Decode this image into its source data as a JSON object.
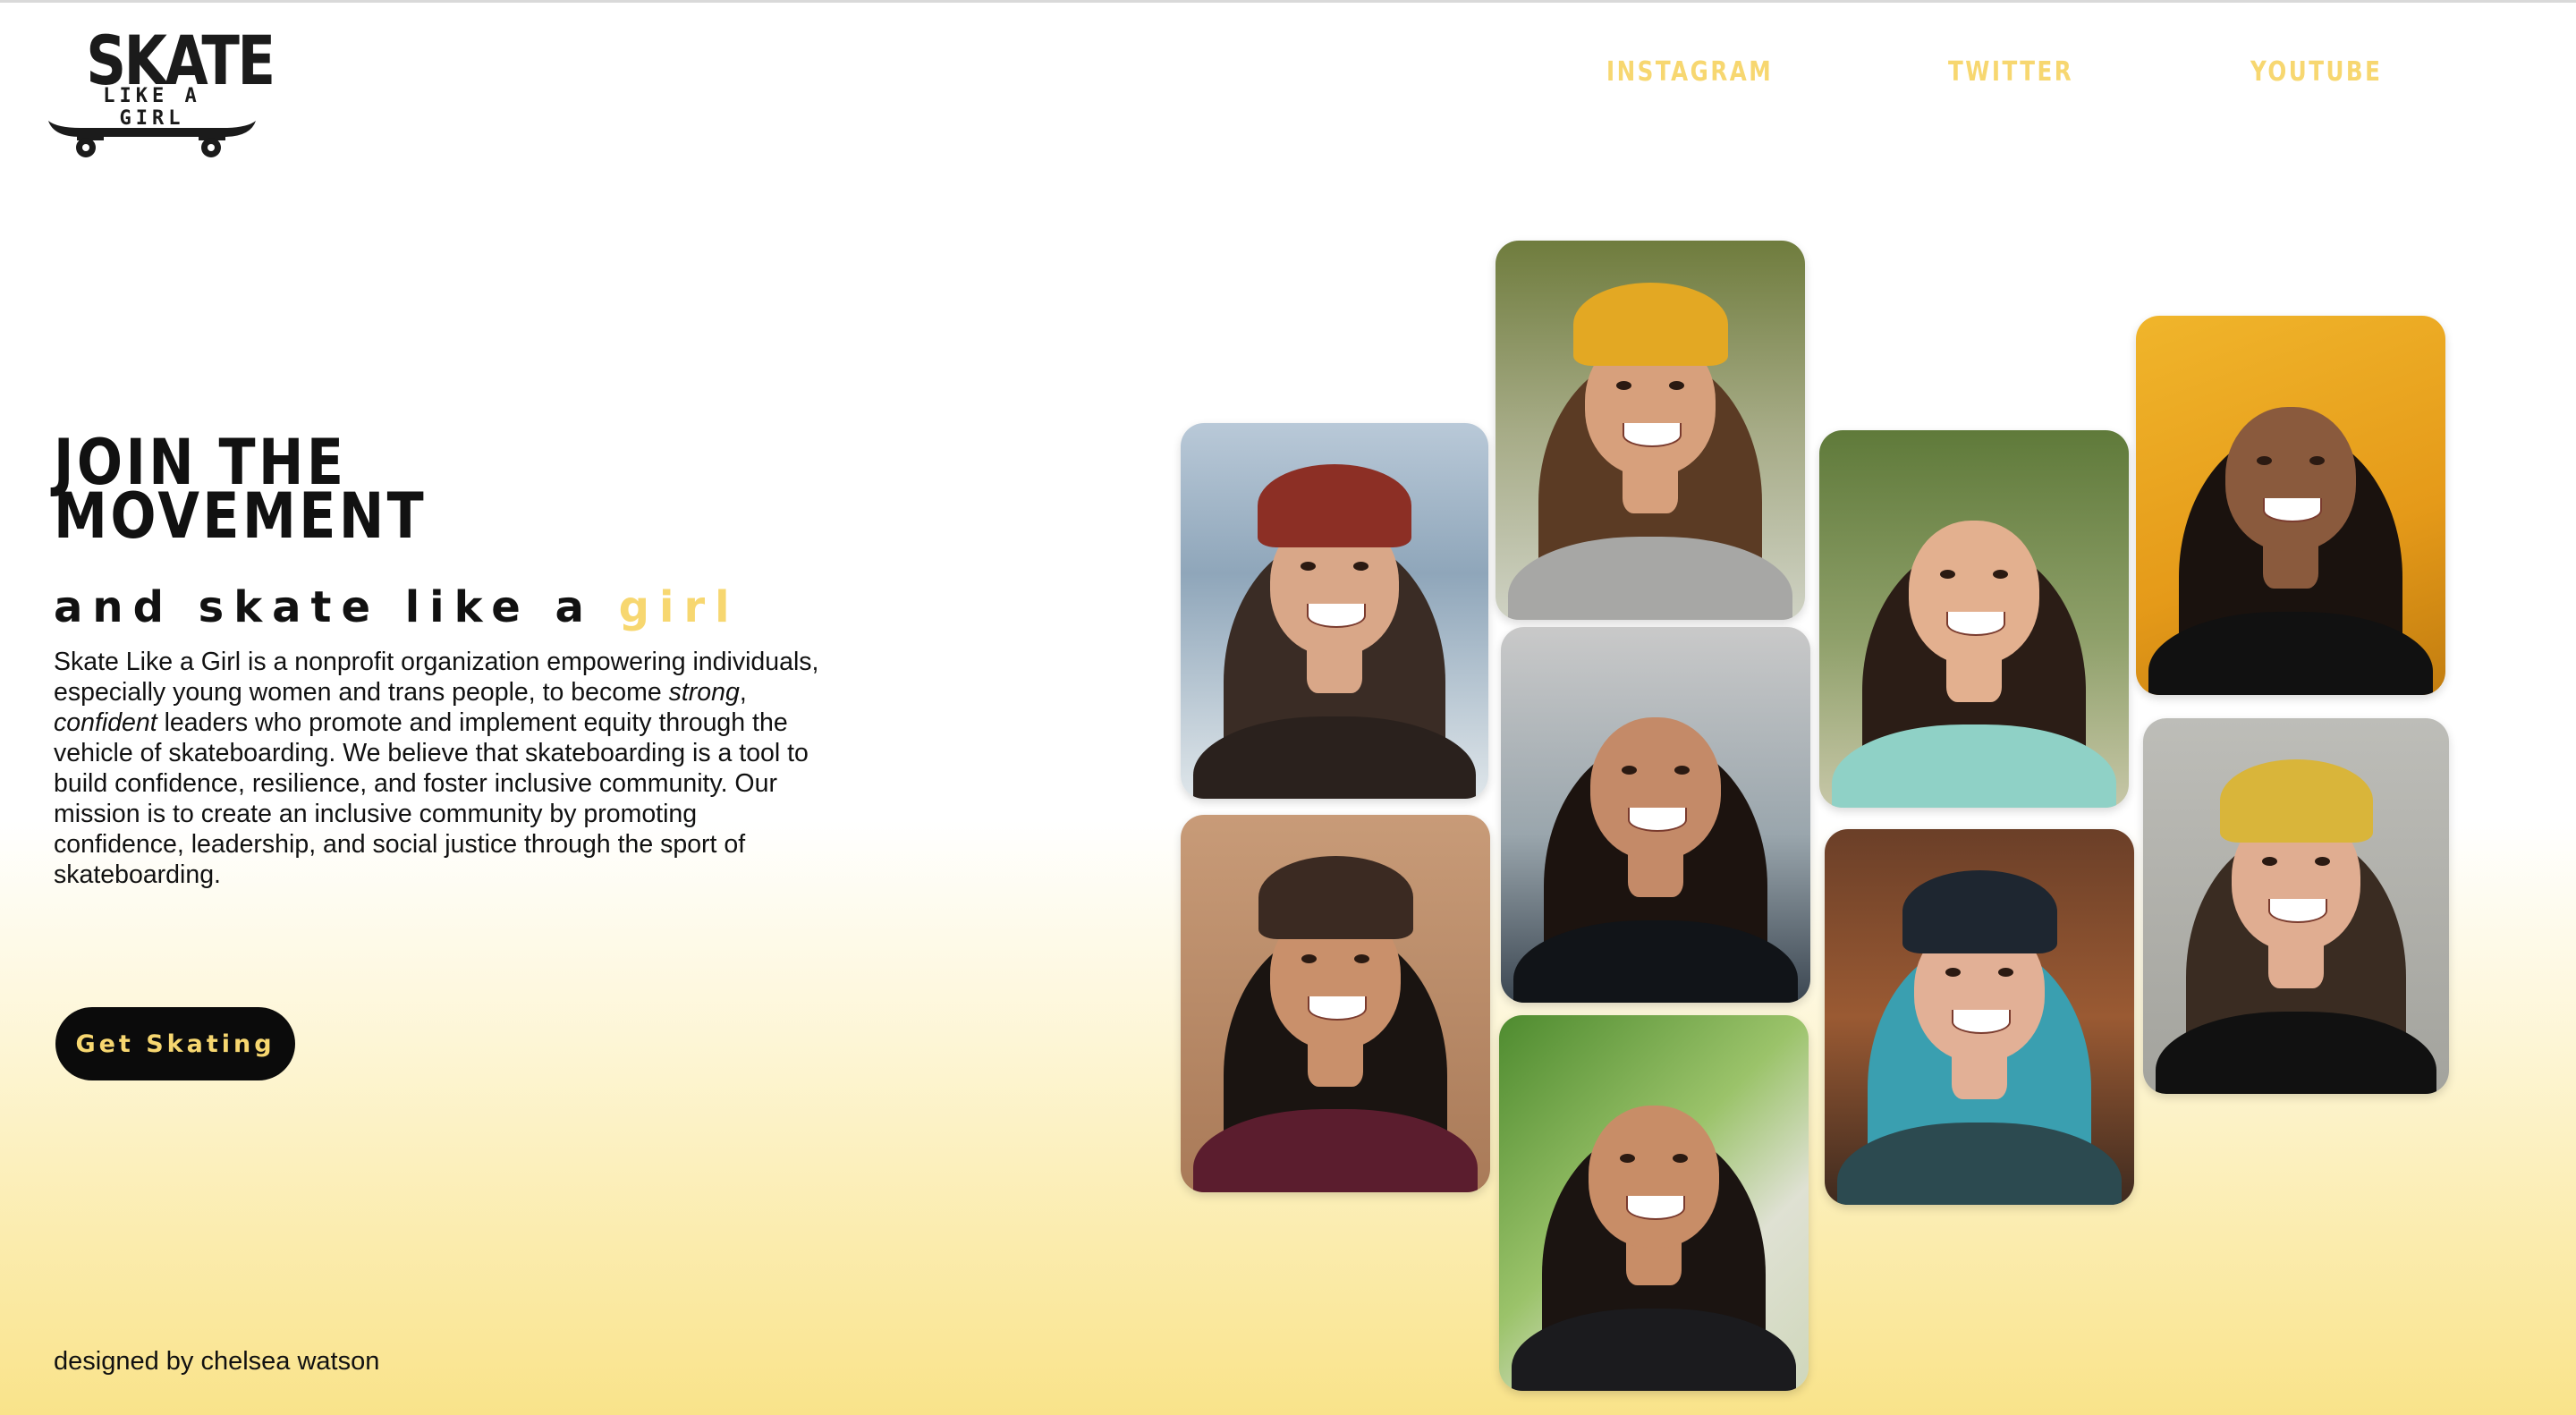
{
  "brand": {
    "logo_word": "SKATE",
    "logo_sub": "LIKE A GIRL"
  },
  "nav": {
    "items": [
      "INSTAGRAM",
      "TWITTER",
      "YOUTUBE"
    ]
  },
  "hero": {
    "headline_line1": "JOIN THE",
    "headline_line2": "MOVEMENT",
    "tagline_prefix": "and skate like a ",
    "tagline_accent": "girl",
    "mission_1": "Skate Like a Girl is a nonprofit organization empowering individuals, especially young women and trans people, to become ",
    "mission_strong": "strong",
    "mission_sep": ", ",
    "mission_confident": "confident",
    "mission_2": " leaders who promote and implement equity through the vehicle of skateboarding. We believe that skateboarding is a tool to build confidence, resilience, and foster inclusive community. Our mission is to create an inclusive community by promoting confidence, leadership, and social justice through the sport of skateboarding.",
    "cta_label": "Get Skating"
  },
  "footer": {
    "credit": "designed by chelsea watson"
  },
  "colors": {
    "accent": "#f7d770",
    "ink": "#111111",
    "button_bg": "#0b0b0b",
    "gradient_bottom": "#f9e38a"
  }
}
